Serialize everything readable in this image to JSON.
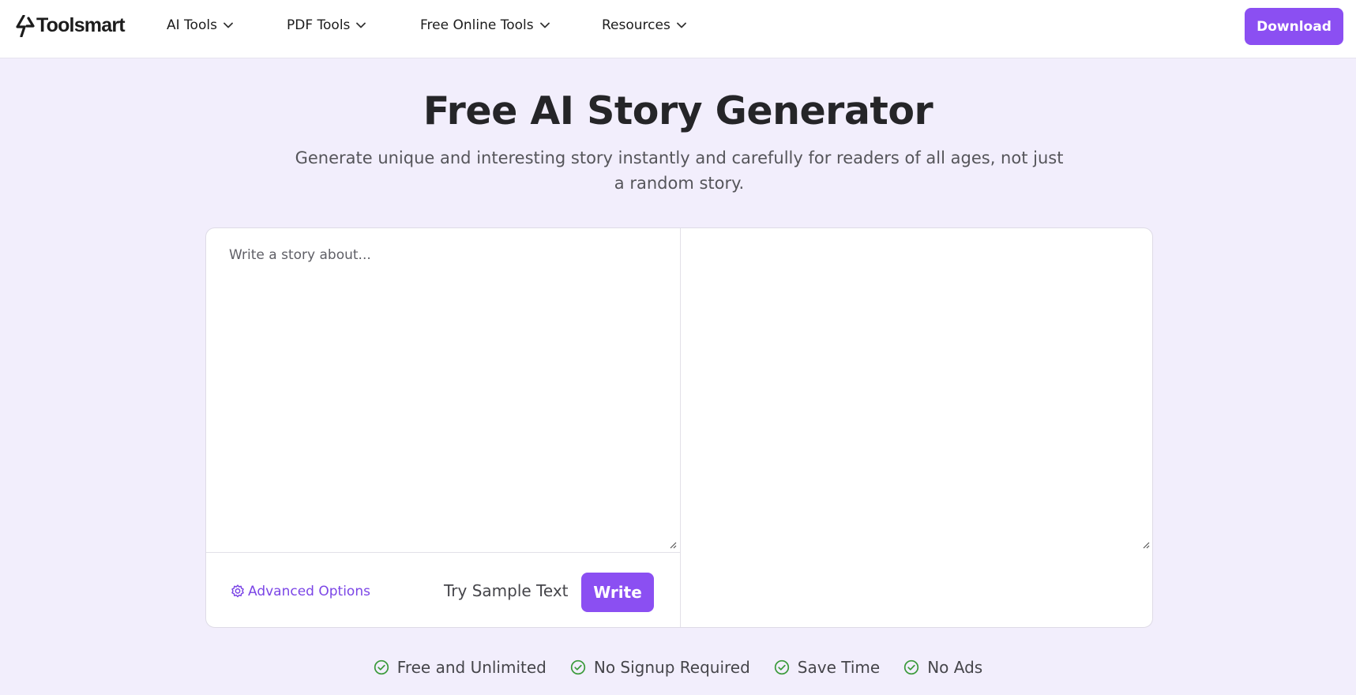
{
  "header": {
    "logo_text": "Toolsmart",
    "nav": [
      {
        "label": "AI Tools"
      },
      {
        "label": "PDF Tools"
      },
      {
        "label": "Free Online Tools"
      },
      {
        "label": "Resources"
      }
    ],
    "download_label": "Download"
  },
  "hero": {
    "title": "Free AI Story Generator",
    "subtitle": "Generate unique and interesting story instantly and carefully for readers of all ages, not just a random story."
  },
  "editor": {
    "input_placeholder": "Write a story about...",
    "input_value": "",
    "output_value": "",
    "advanced_options_label": "Advanced Options",
    "sample_text_label": "Try Sample Text",
    "write_label": "Write"
  },
  "features": [
    {
      "label": "Free and Unlimited"
    },
    {
      "label": "No Signup Required"
    },
    {
      "label": "Save Time"
    },
    {
      "label": "No Ads"
    }
  ],
  "colors": {
    "accent": "#8b4ff2",
    "link": "#7b45e6",
    "page_background": "#f2eefc",
    "check": "#3a9a3a"
  },
  "icons": {
    "logo": "lightning-bolt-icon",
    "nav_dropdown": "chevron-down-icon",
    "advanced_options": "gear-icon",
    "feature": "check-circle-icon",
    "resize": "resize-grip-icon"
  }
}
